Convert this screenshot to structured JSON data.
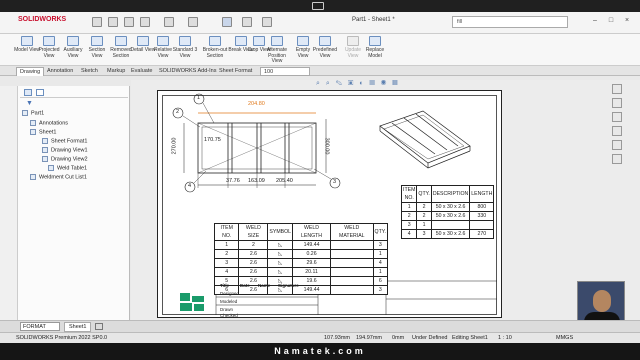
{
  "app": {
    "brand": "SOLIDWORKS",
    "document_title": "Part1 - Sheet1 *",
    "search_placeholder": "fill"
  },
  "ribbon": {
    "buttons": [
      {
        "label": "Model View"
      },
      {
        "label": "Projected View"
      },
      {
        "label": "Auxiliary View"
      },
      {
        "label": "Section View"
      },
      {
        "label": "Removed Section"
      },
      {
        "label": "Detail View"
      },
      {
        "label": "Relative View"
      },
      {
        "label": "Standard 3 View"
      },
      {
        "label": "Broken-out Section"
      },
      {
        "label": "Break View"
      },
      {
        "label": "Crop View"
      },
      {
        "label": "Alternate Position View"
      },
      {
        "label": "Empty View"
      },
      {
        "label": "Predefined View"
      },
      {
        "label": "Update View"
      },
      {
        "label": "Replace Model"
      }
    ]
  },
  "tabs": [
    "Drawing",
    "Annotation",
    "Sketch",
    "Markup",
    "Evaluate",
    "SOLIDWORKS Add-Ins",
    "Sheet Format"
  ],
  "tab_extra": "100",
  "tree": {
    "items": [
      "Part1",
      "Annotations",
      "Sheet1",
      "Sheet Format1",
      "Drawing View1",
      "Drawing View2",
      "Weld Table1",
      "Weldment Cut List1"
    ]
  },
  "drawing": {
    "dims": {
      "top": "204.80",
      "left": "270.00",
      "right": "300.00",
      "inner": "170.75",
      "b1": "37.76",
      "b2": "163.09",
      "b3": "205.40"
    },
    "balloons": [
      "1",
      "2",
      "3",
      "4"
    ]
  },
  "cutlist": {
    "headers": [
      "ITEM NO.",
      "QTY.",
      "DESCRIPTION",
      "LENGTH"
    ],
    "rows": [
      [
        "1",
        "2",
        "50 x 30 x 2.6",
        "800"
      ],
      [
        "2",
        "2",
        "50 x 30 x 2.6",
        "330"
      ],
      [
        "3",
        "1",
        "",
        ""
      ],
      [
        "4",
        "3",
        "50 x 30 x 2.6",
        "270"
      ]
    ]
  },
  "weldtable": {
    "headers": [
      "ITEM NO.",
      "WELD SIZE",
      "SYMBOL",
      "WELD LENGTH",
      "WELD MATERIAL",
      "QTY."
    ],
    "rows": [
      [
        "1",
        "2",
        "",
        "149.44",
        "",
        "3"
      ],
      [
        "2",
        "2.6",
        "",
        "0.26",
        "",
        "1"
      ],
      [
        "3",
        "2.6",
        "",
        "29.6",
        "",
        "4"
      ],
      [
        "4",
        "2.6",
        "",
        "20.11",
        "",
        "1"
      ],
      [
        "5",
        "2.6",
        "",
        "19.6",
        "",
        "6"
      ],
      [
        "6",
        "2.6",
        "",
        "149.44",
        "",
        "3"
      ]
    ]
  },
  "titleblock": {
    "labels": [
      "Title",
      "Date",
      "Name",
      "Signature",
      "Designed",
      "Modeled",
      "Drawn",
      "Checked"
    ]
  },
  "sheet_tab": "Sheet1",
  "format_select": "FORMAT",
  "status": {
    "product": "SOLIDWORKS Premium 2022 SP0.0",
    "x": "107.93mm",
    "y": "194.97mm",
    "z": "0mm",
    "state": "Under Defined",
    "mode": "Editing Sheet1",
    "scale": "1 : 10",
    "units": "MMGS"
  },
  "footer": "Namatek.com",
  "colors": {
    "accent": "#c8102e",
    "dim_orange": "#e07a1e",
    "ribbon_icon": "#6b8fbf"
  }
}
